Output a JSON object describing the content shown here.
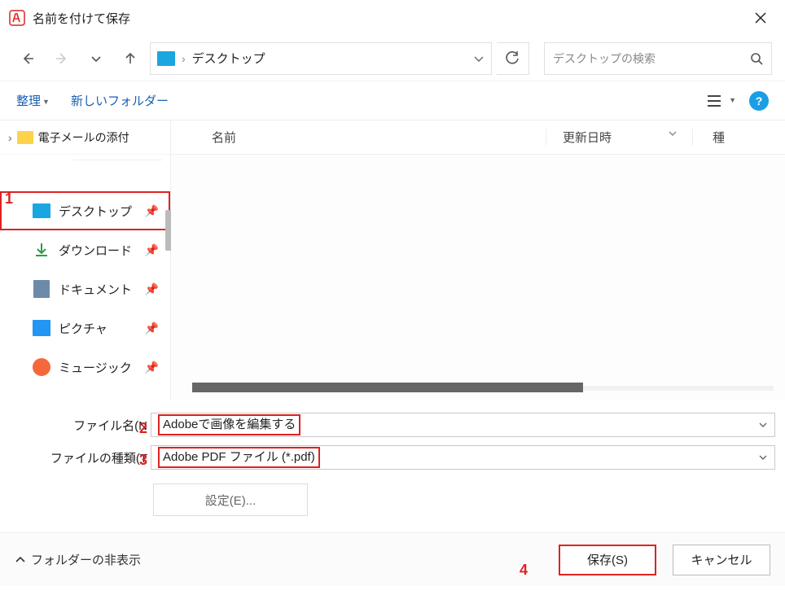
{
  "window": {
    "title": "名前を付けて保存"
  },
  "breadcrumb": {
    "location": "デスクトップ"
  },
  "search": {
    "placeholder": "デスクトップの検索"
  },
  "toolbar": {
    "organize": "整理",
    "new_folder": "新しいフォルダー"
  },
  "tree": {
    "top_folder": "電子メールの添付"
  },
  "quick_access": {
    "items": [
      {
        "label": "デスクトップ"
      },
      {
        "label": "ダウンロード"
      },
      {
        "label": "ドキュメント"
      },
      {
        "label": "ピクチャ"
      },
      {
        "label": "ミュージック"
      }
    ]
  },
  "list_header": {
    "name": "名前",
    "date": "更新日時",
    "type": "種"
  },
  "fields": {
    "filename_label": "ファイル名(N",
    "filename_value": "Adobeで画像を編集する",
    "filetype_label": "ファイルの種類(T",
    "filetype_value": "Adobe PDF ファイル (*.pdf)",
    "settings": "設定(E)..."
  },
  "footer": {
    "hide_folders": "フォルダーの非表示",
    "save": "保存(S)",
    "cancel": "キャンセル"
  },
  "annotations": {
    "a1": "1",
    "a2": "2",
    "a3": "3",
    "a4": "4"
  }
}
